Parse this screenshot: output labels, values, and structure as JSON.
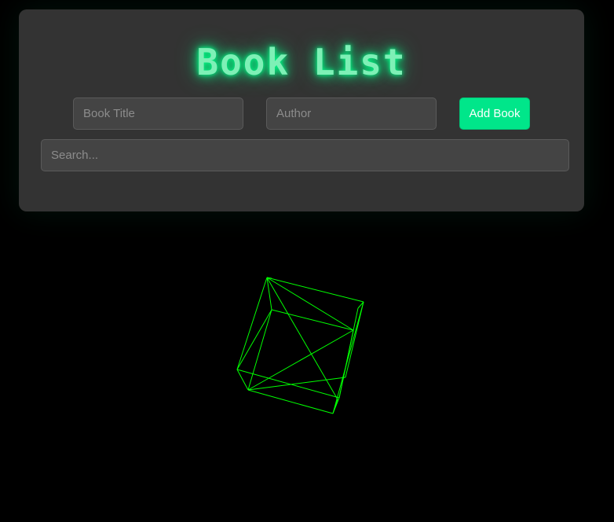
{
  "app": {
    "title": "Book List"
  },
  "form": {
    "title_placeholder": "Book Title",
    "author_placeholder": "Author",
    "add_button_label": "Add Book",
    "search_placeholder": "Search..."
  },
  "colors": {
    "background": "#000000",
    "panel": "#333333",
    "accent": "#00e68a",
    "title_glow": "#00ff88",
    "wireframe": "#00ff00"
  }
}
